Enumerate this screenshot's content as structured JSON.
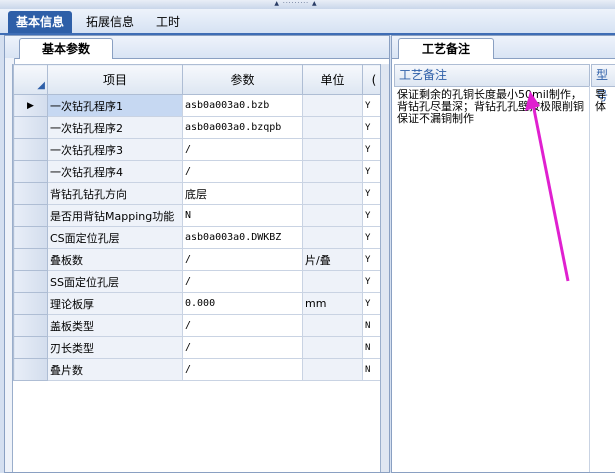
{
  "main_tabs": [
    "基本信息",
    "拓展信息",
    "工时"
  ],
  "left_panel": {
    "tab_label": "基本参数"
  },
  "grid": {
    "columns": [
      "项目",
      "参数",
      "单位",
      "("
    ],
    "rows": [
      {
        "item": "一次钻孔程序1",
        "param": "asb0a003a0.bzb",
        "unit": "",
        "flag": "Y"
      },
      {
        "item": "一次钻孔程序2",
        "param": "asb0a003a0.bzqpb",
        "unit": "",
        "flag": "Y"
      },
      {
        "item": "一次钻孔程序3",
        "param": "/",
        "unit": "",
        "flag": "Y"
      },
      {
        "item": "一次钻孔程序4",
        "param": "/",
        "unit": "",
        "flag": "Y"
      },
      {
        "item": "背钻孔钻孔方向",
        "param": "底层",
        "unit": "",
        "flag": "Y"
      },
      {
        "item": "是否用背钻Mapping功能",
        "param": "N",
        "unit": "",
        "flag": "Y"
      },
      {
        "item": "CS面定位孔层",
        "param": "asb0a003a0.DWKBZ",
        "unit": "",
        "flag": "Y"
      },
      {
        "item": "叠板数",
        "param": "/",
        "unit": "片/叠",
        "flag": "Y"
      },
      {
        "item": "SS面定位孔层",
        "param": "/",
        "unit": "",
        "flag": "Y"
      },
      {
        "item": "理论板厚",
        "param": "0.000",
        "unit": "mm",
        "flag": "Y"
      },
      {
        "item": "盖板类型",
        "param": "/",
        "unit": "",
        "flag": "N"
      },
      {
        "item": "刃长类型",
        "param": "/",
        "unit": "",
        "flag": "N"
      },
      {
        "item": "叠片数",
        "param": "/",
        "unit": "",
        "flag": "N"
      }
    ]
  },
  "right_panel": {
    "tab_label": "工艺备注",
    "col1_header": "工艺备注",
    "col2_header": "型号",
    "note_text": "保证剩余的孔铜长度最小50mil制作，背钻孔尽量深；背钻孔孔壁按极限削铜保证不漏铜制作",
    "col2_text": "导体"
  },
  "annotation_color": "#e020d0"
}
